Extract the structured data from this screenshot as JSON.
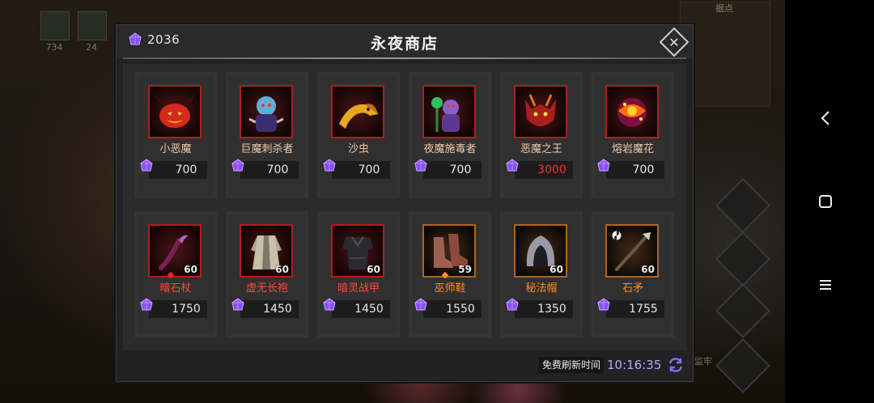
{
  "background": {
    "slot_counts": [
      "734",
      "24"
    ],
    "minimap_title": "据点",
    "side_label": "监牢"
  },
  "shop": {
    "title": "永夜商店",
    "currency": {
      "icon": "purple-crystal-icon",
      "amount": "2036"
    },
    "refresh_label": "免费刷新时间",
    "refresh_timer": "10:16:35",
    "heroes": [
      {
        "name": "小恶魔",
        "price": "700",
        "icon": "pumpkin-imp-icon"
      },
      {
        "name": "巨魔刺杀者",
        "price": "700",
        "icon": "troll-assassin-icon"
      },
      {
        "name": "沙虫",
        "price": "700",
        "icon": "sandworm-icon"
      },
      {
        "name": "夜魔施毒者",
        "price": "700",
        "icon": "night-poisoner-icon"
      },
      {
        "name": "恶魔之王",
        "price": "3000",
        "icon": "demon-king-icon"
      },
      {
        "name": "熔岩魔花",
        "price": "700",
        "icon": "lava-flower-icon"
      }
    ],
    "equipment": [
      {
        "name": "暗石杖",
        "price": "1750",
        "level": "60",
        "icon": "dark-staff-icon"
      },
      {
        "name": "虚无长袍",
        "price": "1450",
        "level": "60",
        "icon": "robe-icon"
      },
      {
        "name": "暗灵战甲",
        "price": "1450",
        "level": "60",
        "icon": "armor-icon"
      },
      {
        "name": "巫师鞋",
        "price": "1550",
        "level": "59",
        "icon": "boots-icon"
      },
      {
        "name": "秘法帽",
        "price": "1350",
        "level": "60",
        "icon": "hood-icon"
      },
      {
        "name": "石矛",
        "price": "1755",
        "level": "60",
        "icon": "spear-icon"
      }
    ]
  },
  "colors": {
    "crystal": "#8a4fff",
    "price_red": "#ff2a2a",
    "frame_red": "#b41c1c",
    "frame_orange": "#b0651e"
  }
}
